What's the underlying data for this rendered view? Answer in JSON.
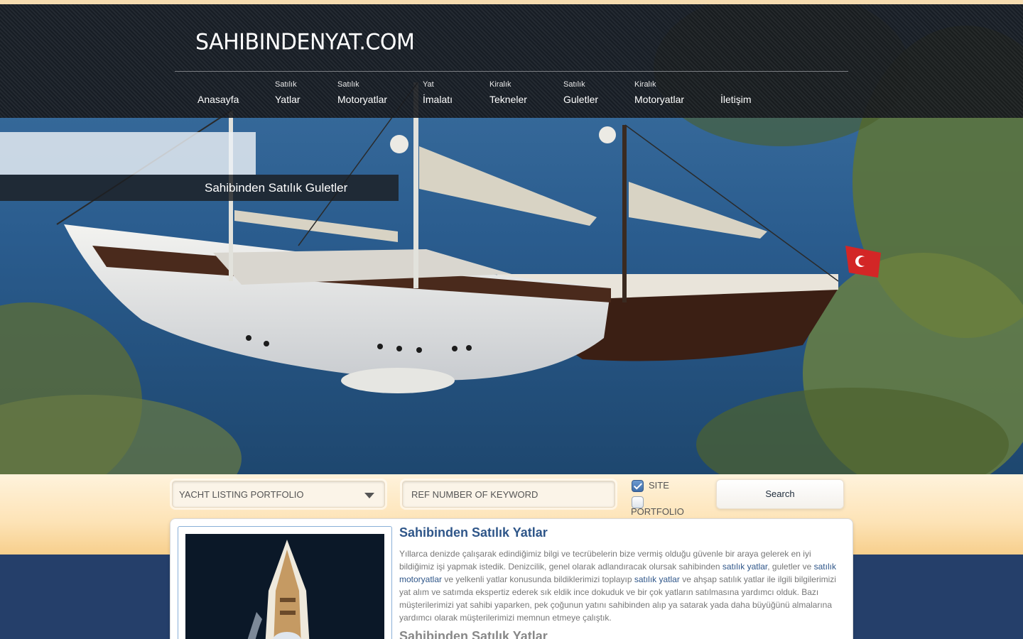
{
  "site": {
    "logo": "SAHIBINDENYAT.COM"
  },
  "nav": [
    {
      "small": "",
      "label": "Anasayfa"
    },
    {
      "small": "Satılık",
      "label": "Yatlar"
    },
    {
      "small": "Satılık",
      "label": "Motoryatlar"
    },
    {
      "small": "Yat",
      "label": "İmalatı"
    },
    {
      "small": "Kiralık",
      "label": "Tekneler"
    },
    {
      "small": "Satılık",
      "label": "Guletler"
    },
    {
      "small": "Kiralık",
      "label": "Motoryatlar"
    },
    {
      "small": "",
      "label": "İletişim"
    }
  ],
  "hero": {
    "caption": "Sahibinden Satılık Guletler"
  },
  "search": {
    "select_value": "YACHT LISTING PORTFOLIO",
    "text_placeholder": "REF NUMBER OF KEYWORD",
    "checkbox_site": {
      "label": "SITE",
      "checked": true
    },
    "checkbox_portfolio": {
      "label": "PORTFOLIO",
      "checked": false
    },
    "button_label": "Search"
  },
  "content": {
    "title": "Sahibinden Satılık Yatlar",
    "p_part1": "Yıllarca denizde çalışarak edindiğimiz bilgi ve tecrübelerin bize vermiş olduğu güvenle bir araya gelerek en iyi bildiğimiz işi yapmak istedik. Denizcilik, genel olarak adlandıracak olursak sahibinden ",
    "link1": "satılık yatlar",
    "p_part2": ", guletler ve ",
    "link2": "satılık motoryatlar",
    "p_part3": " ve yelkenli yatlar konusunda bildiklerimizi toplayıp ",
    "link3": "satılık yatlar",
    "p_part4": " ve ahşap satılık yatlar ile ilgili bilgilerimizi yat alım ve satımda ekspertiz ederek sık eldik ince dokuduk ve bir çok yatların satılmasına yardımcı olduk. Bazı müşterilerimizi yat sahibi yaparken, pek çoğunun yatını sahibinden alıp ya satarak yada daha büyüğünü almalarına yardımcı olarak müşterilerimizi memnun etmeye çalıştık.",
    "title2": "Sahibinden Satılık Yatlar"
  },
  "colors": {
    "accent": "#2f5689",
    "band": "#fde3b6",
    "footer_bg": "#253f6a"
  }
}
